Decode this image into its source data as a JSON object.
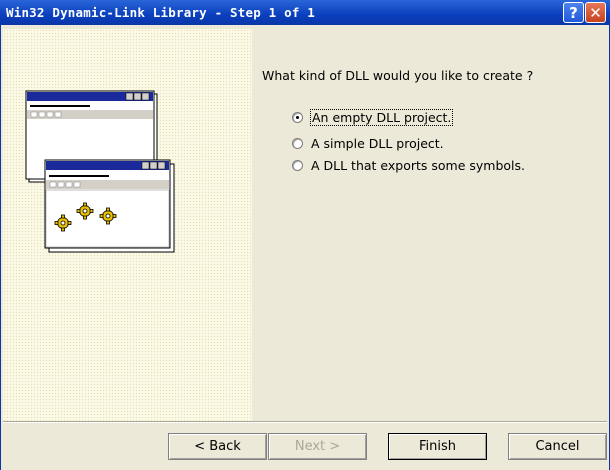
{
  "window": {
    "title": "Win32 Dynamic-Link Library - Step 1 of 1",
    "help_glyph": "?",
    "close_glyph": "✕"
  },
  "question": "What kind of DLL would you like to create ?",
  "options": [
    {
      "label": "An empty DLL project.",
      "selected": true
    },
    {
      "label": "A simple DLL project.",
      "selected": false
    },
    {
      "label": "A DLL that exports some symbols.",
      "selected": false
    }
  ],
  "buttons": {
    "back": "< Back",
    "next": "Next >",
    "finish": "Finish",
    "cancel": "Cancel"
  }
}
